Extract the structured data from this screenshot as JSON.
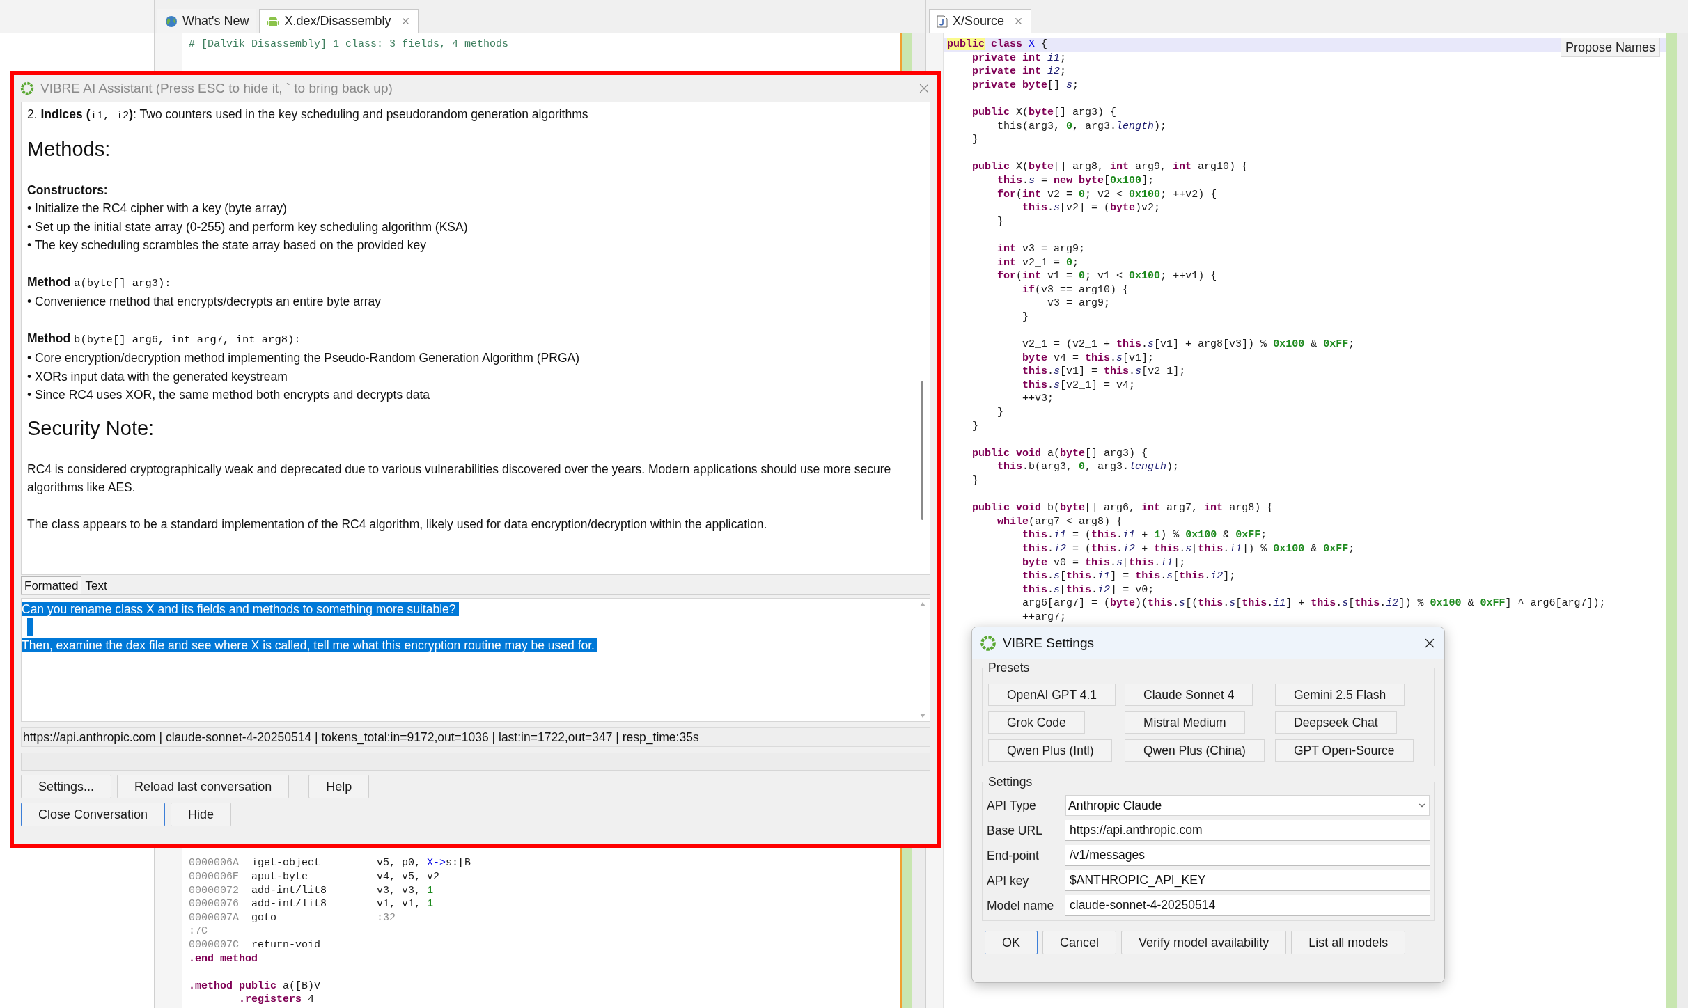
{
  "editor_tabs": [
    {
      "label": "What's New",
      "kind": "globe",
      "selected": false,
      "closable": false
    },
    {
      "label": "X.dex/Disassembly",
      "kind": "android",
      "selected": true,
      "closable": true
    }
  ],
  "disassembly": {
    "top_blocks": [
      [
        [
          {
            "kind": "comment",
            "text": "# [Dalvik Disassembly] 1 class: 3 fields, 4 methods"
          }
        ]
      ]
    ],
    "bottom_blocks": [
      [
        [
          {
            "kind": "addr",
            "text": "0000006A"
          },
          {
            "kind": "plain",
            "text": "  iget-object         v5, p0, "
          },
          {
            "kind": "ref",
            "text": "X->"
          },
          {
            "kind": "plain",
            "text": "s:[B"
          }
        ],
        [
          {
            "kind": "addr",
            "text": "0000006E"
          },
          {
            "kind": "plain",
            "text": "  aput-byte           v4, v5, v2"
          }
        ],
        [
          {
            "kind": "addr",
            "text": "00000072"
          },
          {
            "kind": "plain",
            "text": "  add-int/lit8        v3, v3, "
          },
          {
            "kind": "num",
            "text": "1"
          }
        ],
        [
          {
            "kind": "addr",
            "text": "00000076"
          },
          {
            "kind": "plain",
            "text": "  add-int/lit8        v1, v1, "
          },
          {
            "kind": "num",
            "text": "1"
          }
        ],
        [
          {
            "kind": "addr",
            "text": "0000007A"
          },
          {
            "kind": "plain",
            "text": "  goto                "
          },
          {
            "kind": "addr",
            "text": ":32"
          }
        ],
        [
          {
            "kind": "addr",
            "text": ":7C"
          }
        ],
        [
          {
            "kind": "addr",
            "text": "0000007C"
          },
          {
            "kind": "plain",
            "text": "  return-void"
          }
        ],
        [
          {
            "kind": "kw",
            "text": ".end method"
          }
        ]
      ],
      [
        [
          {
            "kind": "kw",
            "text": ".method public"
          },
          {
            "kind": "plain",
            "text": " a([B)V"
          }
        ],
        [
          {
            "kind": "kw",
            "text": "        .registers"
          },
          {
            "kind": "plain",
            "text": " 4"
          }
        ]
      ]
    ]
  },
  "source_tabs": [
    {
      "label": "X/Source",
      "selected": true
    }
  ],
  "propose_names_button": "Propose Names",
  "source": {
    "blocks": [
      [
        {
          "current": true,
          "tokens": [
            {
              "kind": "mark",
              "text": "public"
            },
            {
              "kind": "kw",
              "text": " class"
            },
            {
              "kind": "ref",
              "text": " X"
            },
            {
              "kind": "plain",
              "text": " {"
            }
          ]
        },
        {
          "current": false,
          "tokens": [
            {
              "kind": "kw",
              "text": "    private int "
            },
            {
              "kind": "field",
              "text": "i1"
            },
            {
              "kind": "plain",
              "text": ";"
            }
          ]
        },
        {
          "current": false,
          "tokens": [
            {
              "kind": "kw",
              "text": "    private int "
            },
            {
              "kind": "field",
              "text": "i2"
            },
            {
              "kind": "plain",
              "text": ";"
            }
          ]
        },
        {
          "current": false,
          "tokens": [
            {
              "kind": "kw",
              "text": "    private byte"
            },
            {
              "kind": "plain",
              "text": "[] "
            },
            {
              "kind": "field",
              "text": "s"
            },
            {
              "kind": "plain",
              "text": ";"
            }
          ]
        }
      ],
      [
        {
          "current": false,
          "tokens": [
            {
              "kind": "kw",
              "text": "    public"
            },
            {
              "kind": "plain",
              "text": " X("
            },
            {
              "kind": "kw",
              "text": "byte"
            },
            {
              "kind": "plain",
              "text": "[] arg3) {"
            }
          ]
        },
        {
          "current": false,
          "tokens": [
            {
              "kind": "plain",
              "text": "        this(arg3, "
            },
            {
              "kind": "num",
              "text": "0"
            },
            {
              "kind": "plain",
              "text": ", arg3."
            },
            {
              "kind": "field",
              "text": "length"
            },
            {
              "kind": "plain",
              "text": ");"
            }
          ]
        },
        {
          "current": false,
          "tokens": [
            {
              "kind": "plain",
              "text": "    }"
            }
          ]
        }
      ],
      [
        {
          "current": false,
          "tokens": [
            {
              "kind": "kw",
              "text": "    public"
            },
            {
              "kind": "plain",
              "text": " X("
            },
            {
              "kind": "kw",
              "text": "byte"
            },
            {
              "kind": "plain",
              "text": "[] arg8, "
            },
            {
              "kind": "kw",
              "text": "int"
            },
            {
              "kind": "plain",
              "text": " arg9, "
            },
            {
              "kind": "kw",
              "text": "int"
            },
            {
              "kind": "plain",
              "text": " arg10) {"
            }
          ]
        },
        {
          "current": false,
          "tokens": [
            {
              "kind": "kw",
              "text": "        this"
            },
            {
              "kind": "plain",
              "text": "."
            },
            {
              "kind": "field",
              "text": "s"
            },
            {
              "kind": "plain",
              "text": " = "
            },
            {
              "kind": "kw",
              "text": "new byte"
            },
            {
              "kind": "plain",
              "text": "["
            },
            {
              "kind": "num",
              "text": "0x100"
            },
            {
              "kind": "plain",
              "text": "];"
            }
          ]
        },
        {
          "current": false,
          "tokens": [
            {
              "kind": "kw",
              "text": "        for"
            },
            {
              "kind": "plain",
              "text": "("
            },
            {
              "kind": "kw",
              "text": "int"
            },
            {
              "kind": "plain",
              "text": " v2 = "
            },
            {
              "kind": "num",
              "text": "0"
            },
            {
              "kind": "plain",
              "text": "; v2 < "
            },
            {
              "kind": "num",
              "text": "0x100"
            },
            {
              "kind": "plain",
              "text": "; ++v2) {"
            }
          ]
        },
        {
          "current": false,
          "tokens": [
            {
              "kind": "kw",
              "text": "            this"
            },
            {
              "kind": "plain",
              "text": "."
            },
            {
              "kind": "field",
              "text": "s"
            },
            {
              "kind": "plain",
              "text": "[v2] = ("
            },
            {
              "kind": "kw",
              "text": "byte"
            },
            {
              "kind": "plain",
              "text": ")v2;"
            }
          ]
        },
        {
          "current": false,
          "tokens": [
            {
              "kind": "plain",
              "text": "        }"
            }
          ]
        }
      ],
      [
        {
          "current": false,
          "tokens": [
            {
              "kind": "kw",
              "text": "        int"
            },
            {
              "kind": "plain",
              "text": " v3 = arg9;"
            }
          ]
        },
        {
          "current": false,
          "tokens": [
            {
              "kind": "kw",
              "text": "        int"
            },
            {
              "kind": "plain",
              "text": " v2_1 = "
            },
            {
              "kind": "num",
              "text": "0"
            },
            {
              "kind": "plain",
              "text": ";"
            }
          ]
        },
        {
          "current": false,
          "tokens": [
            {
              "kind": "kw",
              "text": "        for"
            },
            {
              "kind": "plain",
              "text": "("
            },
            {
              "kind": "kw",
              "text": "int"
            },
            {
              "kind": "plain",
              "text": " v1 = "
            },
            {
              "kind": "num",
              "text": "0"
            },
            {
              "kind": "plain",
              "text": "; v1 < "
            },
            {
              "kind": "num",
              "text": "0x100"
            },
            {
              "kind": "plain",
              "text": "; ++v1) {"
            }
          ]
        },
        {
          "current": false,
          "tokens": [
            {
              "kind": "kw",
              "text": "            if"
            },
            {
              "kind": "plain",
              "text": "(v3 == arg10) {"
            }
          ]
        },
        {
          "current": false,
          "tokens": [
            {
              "kind": "plain",
              "text": "                v3 = arg9;"
            }
          ]
        },
        {
          "current": false,
          "tokens": [
            {
              "kind": "plain",
              "text": "            }"
            }
          ]
        }
      ],
      [
        {
          "current": false,
          "tokens": [
            {
              "kind": "plain",
              "text": "            v2_1 = (v2_1 + "
            },
            {
              "kind": "kw",
              "text": "this"
            },
            {
              "kind": "plain",
              "text": "."
            },
            {
              "kind": "field",
              "text": "s"
            },
            {
              "kind": "plain",
              "text": "[v1] + arg8[v3]) % "
            },
            {
              "kind": "num",
              "text": "0x100"
            },
            {
              "kind": "plain",
              "text": " & "
            },
            {
              "kind": "num",
              "text": "0xFF"
            },
            {
              "kind": "plain",
              "text": ";"
            }
          ]
        },
        {
          "current": false,
          "tokens": [
            {
              "kind": "kw",
              "text": "            byte"
            },
            {
              "kind": "plain",
              "text": " v4 = "
            },
            {
              "kind": "kw",
              "text": "this"
            },
            {
              "kind": "plain",
              "text": "."
            },
            {
              "kind": "field",
              "text": "s"
            },
            {
              "kind": "plain",
              "text": "[v1];"
            }
          ]
        },
        {
          "current": false,
          "tokens": [
            {
              "kind": "kw",
              "text": "            this"
            },
            {
              "kind": "plain",
              "text": "."
            },
            {
              "kind": "field",
              "text": "s"
            },
            {
              "kind": "plain",
              "text": "[v1] = "
            },
            {
              "kind": "kw",
              "text": "this"
            },
            {
              "kind": "plain",
              "text": "."
            },
            {
              "kind": "field",
              "text": "s"
            },
            {
              "kind": "plain",
              "text": "[v2_1];"
            }
          ]
        },
        {
          "current": false,
          "tokens": [
            {
              "kind": "kw",
              "text": "            this"
            },
            {
              "kind": "plain",
              "text": "."
            },
            {
              "kind": "field",
              "text": "s"
            },
            {
              "kind": "plain",
              "text": "[v2_1] = v4;"
            }
          ]
        },
        {
          "current": false,
          "tokens": [
            {
              "kind": "plain",
              "text": "            ++v3;"
            }
          ]
        },
        {
          "current": false,
          "tokens": [
            {
              "kind": "plain",
              "text": "        }"
            }
          ]
        },
        {
          "current": false,
          "tokens": [
            {
              "kind": "plain",
              "text": "    }"
            }
          ]
        }
      ],
      [
        {
          "current": false,
          "tokens": [
            {
              "kind": "kw",
              "text": "    public void"
            },
            {
              "kind": "plain",
              "text": " a("
            },
            {
              "kind": "kw",
              "text": "byte"
            },
            {
              "kind": "plain",
              "text": "[] arg3) {"
            }
          ]
        },
        {
          "current": false,
          "tokens": [
            {
              "kind": "kw",
              "text": "        this"
            },
            {
              "kind": "plain",
              "text": ".b(arg3, "
            },
            {
              "kind": "num",
              "text": "0"
            },
            {
              "kind": "plain",
              "text": ", arg3."
            },
            {
              "kind": "field",
              "text": "length"
            },
            {
              "kind": "plain",
              "text": ");"
            }
          ]
        },
        {
          "current": false,
          "tokens": [
            {
              "kind": "plain",
              "text": "    }"
            }
          ]
        }
      ],
      [
        {
          "current": false,
          "tokens": [
            {
              "kind": "kw",
              "text": "    public void"
            },
            {
              "kind": "plain",
              "text": " b("
            },
            {
              "kind": "kw",
              "text": "byte"
            },
            {
              "kind": "plain",
              "text": "[] arg6, "
            },
            {
              "kind": "kw",
              "text": "int"
            },
            {
              "kind": "plain",
              "text": " arg7, "
            },
            {
              "kind": "kw",
              "text": "int"
            },
            {
              "kind": "plain",
              "text": " arg8) {"
            }
          ]
        },
        {
          "current": false,
          "tokens": [
            {
              "kind": "kw",
              "text": "        while"
            },
            {
              "kind": "plain",
              "text": "(arg7 < arg8) {"
            }
          ]
        },
        {
          "current": false,
          "tokens": [
            {
              "kind": "kw",
              "text": "            this"
            },
            {
              "kind": "plain",
              "text": "."
            },
            {
              "kind": "field",
              "text": "i1"
            },
            {
              "kind": "plain",
              "text": " = ("
            },
            {
              "kind": "kw",
              "text": "this"
            },
            {
              "kind": "plain",
              "text": "."
            },
            {
              "kind": "field",
              "text": "i1"
            },
            {
              "kind": "plain",
              "text": " + "
            },
            {
              "kind": "num",
              "text": "1"
            },
            {
              "kind": "plain",
              "text": ") % "
            },
            {
              "kind": "num",
              "text": "0x100"
            },
            {
              "kind": "plain",
              "text": " & "
            },
            {
              "kind": "num",
              "text": "0xFF"
            },
            {
              "kind": "plain",
              "text": ";"
            }
          ]
        },
        {
          "current": false,
          "tokens": [
            {
              "kind": "kw",
              "text": "            this"
            },
            {
              "kind": "plain",
              "text": "."
            },
            {
              "kind": "field",
              "text": "i2"
            },
            {
              "kind": "plain",
              "text": " = ("
            },
            {
              "kind": "kw",
              "text": "this"
            },
            {
              "kind": "plain",
              "text": "."
            },
            {
              "kind": "field",
              "text": "i2"
            },
            {
              "kind": "plain",
              "text": " + "
            },
            {
              "kind": "kw",
              "text": "this"
            },
            {
              "kind": "plain",
              "text": "."
            },
            {
              "kind": "field",
              "text": "s"
            },
            {
              "kind": "plain",
              "text": "["
            },
            {
              "kind": "kw",
              "text": "this"
            },
            {
              "kind": "plain",
              "text": "."
            },
            {
              "kind": "field",
              "text": "i1"
            },
            {
              "kind": "plain",
              "text": "]) % "
            },
            {
              "kind": "num",
              "text": "0x100"
            },
            {
              "kind": "plain",
              "text": " & "
            },
            {
              "kind": "num",
              "text": "0xFF"
            },
            {
              "kind": "plain",
              "text": ";"
            }
          ]
        },
        {
          "current": false,
          "tokens": [
            {
              "kind": "kw",
              "text": "            byte"
            },
            {
              "kind": "plain",
              "text": " v0 = "
            },
            {
              "kind": "kw",
              "text": "this"
            },
            {
              "kind": "plain",
              "text": "."
            },
            {
              "kind": "field",
              "text": "s"
            },
            {
              "kind": "plain",
              "text": "["
            },
            {
              "kind": "kw",
              "text": "this"
            },
            {
              "kind": "plain",
              "text": "."
            },
            {
              "kind": "field",
              "text": "i1"
            },
            {
              "kind": "plain",
              "text": "];"
            }
          ]
        },
        {
          "current": false,
          "tokens": [
            {
              "kind": "kw",
              "text": "            this"
            },
            {
              "kind": "plain",
              "text": "."
            },
            {
              "kind": "field",
              "text": "s"
            },
            {
              "kind": "plain",
              "text": "["
            },
            {
              "kind": "kw",
              "text": "this"
            },
            {
              "kind": "plain",
              "text": "."
            },
            {
              "kind": "field",
              "text": "i1"
            },
            {
              "kind": "plain",
              "text": "] = "
            },
            {
              "kind": "kw",
              "text": "this"
            },
            {
              "kind": "plain",
              "text": "."
            },
            {
              "kind": "field",
              "text": "s"
            },
            {
              "kind": "plain",
              "text": "["
            },
            {
              "kind": "kw",
              "text": "this"
            },
            {
              "kind": "plain",
              "text": "."
            },
            {
              "kind": "field",
              "text": "i2"
            },
            {
              "kind": "plain",
              "text": "];"
            }
          ]
        },
        {
          "current": false,
          "tokens": [
            {
              "kind": "kw",
              "text": "            this"
            },
            {
              "kind": "plain",
              "text": "."
            },
            {
              "kind": "field",
              "text": "s"
            },
            {
              "kind": "plain",
              "text": "["
            },
            {
              "kind": "kw",
              "text": "this"
            },
            {
              "kind": "plain",
              "text": "."
            },
            {
              "kind": "field",
              "text": "i2"
            },
            {
              "kind": "plain",
              "text": "] = v0;"
            }
          ]
        },
        {
          "current": false,
          "tokens": [
            {
              "kind": "plain",
              "text": "            arg6[arg7] = ("
            },
            {
              "kind": "kw",
              "text": "byte"
            },
            {
              "kind": "plain",
              "text": ")("
            },
            {
              "kind": "kw",
              "text": "this"
            },
            {
              "kind": "plain",
              "text": "."
            },
            {
              "kind": "field",
              "text": "s"
            },
            {
              "kind": "plain",
              "text": "[("
            },
            {
              "kind": "kw",
              "text": "this"
            },
            {
              "kind": "plain",
              "text": "."
            },
            {
              "kind": "field",
              "text": "s"
            },
            {
              "kind": "plain",
              "text": "["
            },
            {
              "kind": "kw",
              "text": "this"
            },
            {
              "kind": "plain",
              "text": "."
            },
            {
              "kind": "field",
              "text": "i1"
            },
            {
              "kind": "plain",
              "text": "] + "
            },
            {
              "kind": "kw",
              "text": "this"
            },
            {
              "kind": "plain",
              "text": "."
            },
            {
              "kind": "field",
              "text": "s"
            },
            {
              "kind": "plain",
              "text": "["
            },
            {
              "kind": "kw",
              "text": "this"
            },
            {
              "kind": "plain",
              "text": "."
            },
            {
              "kind": "field",
              "text": "i2"
            },
            {
              "kind": "plain",
              "text": "]) % "
            },
            {
              "kind": "num",
              "text": "0x100"
            },
            {
              "kind": "plain",
              "text": " & "
            },
            {
              "kind": "num",
              "text": "0xFF"
            },
            {
              "kind": "plain",
              "text": "] ^ arg6[arg7]);"
            }
          ]
        },
        {
          "current": false,
          "tokens": [
            {
              "kind": "plain",
              "text": "            ++arg7;"
            }
          ]
        }
      ]
    ]
  },
  "ai_assistant": {
    "title": "VIBRE AI Assistant (Press ESC to hide it, ` to bring back up)",
    "response": [
      {
        "kind": "para",
        "lines": [
          [
            {
              "kind": "normal",
              "text": "2. "
            },
            {
              "kind": "bold",
              "text": "Indices ("
            },
            {
              "kind": "code",
              "text": "i1, i2"
            },
            {
              "kind": "bold",
              "text": ")"
            },
            {
              "kind": "normal",
              "text": ": Two counters used in the key scheduling and pseudorandom generation algorithms"
            }
          ]
        ]
      },
      {
        "kind": "heading",
        "text": "Methods:"
      },
      {
        "kind": "para",
        "lines": [
          [
            {
              "kind": "bold",
              "text": "Constructors:"
            }
          ],
          [
            {
              "kind": "normal",
              "text": "• Initialize the RC4 cipher with a key (byte array)"
            }
          ],
          [
            {
              "kind": "normal",
              "text": "• Set up the initial state array (0-255) and perform key scheduling algorithm (KSA)"
            }
          ],
          [
            {
              "kind": "normal",
              "text": "• The key scheduling scrambles the state array based on the provided key"
            }
          ]
        ]
      },
      {
        "kind": "para",
        "lines": [
          [
            {
              "kind": "bold",
              "text": "Method "
            },
            {
              "kind": "code",
              "text": "a(byte[] arg3):"
            }
          ],
          [
            {
              "kind": "normal",
              "text": "• Convenience method that encrypts/decrypts an entire byte array"
            }
          ]
        ]
      },
      {
        "kind": "para",
        "lines": [
          [
            {
              "kind": "bold",
              "text": "Method "
            },
            {
              "kind": "code",
              "text": "b(byte[] arg6, int arg7, int arg8):"
            }
          ],
          [
            {
              "kind": "normal",
              "text": "• Core encryption/decryption method implementing the Pseudo-Random Generation Algorithm (PRGA)"
            }
          ],
          [
            {
              "kind": "normal",
              "text": "• XORs input data with the generated keystream"
            }
          ],
          [
            {
              "kind": "normal",
              "text": "• Since RC4 uses XOR, the same method both encrypts and decrypts data"
            }
          ]
        ]
      },
      {
        "kind": "heading",
        "text": "Security Note:"
      },
      {
        "kind": "para",
        "lines": [
          [
            {
              "kind": "normal",
              "text": "RC4 is considered cryptographically weak and deprecated due to various vulnerabilities discovered over the years. Modern applications should use more secure algorithms like AES."
            }
          ]
        ]
      },
      {
        "kind": "para",
        "lines": [
          [
            {
              "kind": "normal",
              "text": "The class appears to be a standard implementation of the RC4 algorithm, likely used for data encryption/decryption within the application."
            }
          ]
        ]
      }
    ],
    "view_tabs": [
      {
        "label": "Formatted",
        "selected": true
      },
      {
        "label": "Text",
        "selected": false
      }
    ],
    "prompt": {
      "selected": true,
      "paragraphs": [
        "Can you rename class X and its fields and methods to something more suitable?",
        "Then, examine the dex file and see where X is called, tell me what this encryption routine may be used for."
      ]
    },
    "status": "https://api.anthropic.com | claude-sonnet-4-20250514 | tokens_total:in=9172,out=1036 | last:in=1722,out=347 | resp_time:35s",
    "button_rows": [
      [
        {
          "label": "Settings...",
          "default": false
        },
        {
          "label": "Reload last conversation",
          "default": false
        },
        {
          "label": "Help",
          "default": false
        }
      ],
      [
        {
          "label": "Close Conversation",
          "default": true
        },
        {
          "label": "Hide",
          "default": false
        }
      ]
    ]
  },
  "settings_dialog": {
    "title": "VIBRE Settings",
    "presets_label": "Presets",
    "presets": [
      "OpenAI GPT 4.1",
      "Claude Sonnet 4",
      "Gemini 2.5 Flash",
      "Grok Code",
      "Mistral Medium",
      "Deepseek Chat",
      "Qwen Plus (Intl)",
      "Qwen Plus (China)",
      "GPT Open-Source"
    ],
    "settings_label": "Settings",
    "fields": [
      {
        "label": "API Type",
        "value": "Anthropic Claude",
        "kind": "select"
      },
      {
        "label": "Base URL",
        "value": "https://api.anthropic.com",
        "kind": "text"
      },
      {
        "label": "End-point",
        "value": "/v1/messages",
        "kind": "text"
      },
      {
        "label": "API key",
        "value": "$ANTHROPIC_API_KEY",
        "kind": "text"
      },
      {
        "label": "Model name",
        "value": "claude-sonnet-4-20250514",
        "kind": "text"
      }
    ],
    "buttons": [
      {
        "label": "OK",
        "default": true
      },
      {
        "label": "Cancel",
        "default": false
      },
      {
        "label": "Verify model availability",
        "default": false
      },
      {
        "label": "List all models",
        "default": false
      }
    ]
  }
}
